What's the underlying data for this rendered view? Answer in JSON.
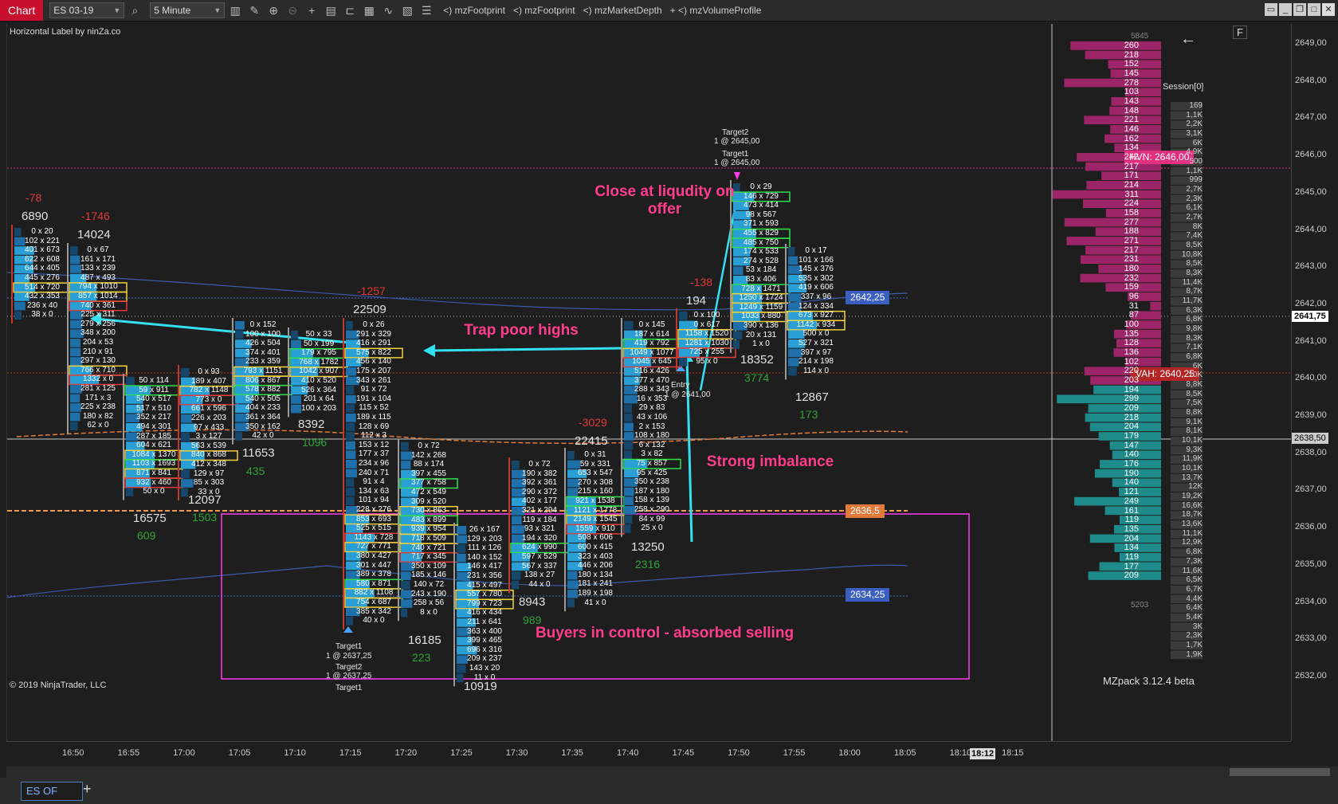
{
  "toolbar": {
    "chart_label": "Chart",
    "instrument": "ES 03-19",
    "interval": "5 Minute",
    "indicators": [
      "<) mzFootprint",
      "<) mzFootprint",
      "<) mzMarketDepth",
      "+ <) mzVolumeProfile"
    ]
  },
  "chart": {
    "top_left_label": "Horizontal Label by ninZa.co",
    "copyright": "© 2019 NinjaTrader, LLC",
    "watermark": "MZpack 3.12.4 beta",
    "profile_title": "Session[0]",
    "profile_top_value": "5845",
    "profile_bottom_value": "5203",
    "f_button": "F",
    "back_arrow": "←"
  },
  "price_axis": {
    "labels": [
      "2649,00",
      "2648,00",
      "2647,00",
      "2646,00",
      "2645,00",
      "2644,00",
      "2643,00",
      "2642,00",
      "2641,00",
      "2640,00",
      "2639,00",
      "2638,00",
      "2637,00",
      "2636,00",
      "2635,00",
      "2634,00",
      "2633,00",
      "2632,00"
    ],
    "current_price": "2641,75",
    "crosshair_price": "2638,50"
  },
  "time_axis": {
    "labels": [
      "16:50",
      "16:55",
      "17:00",
      "17:05",
      "17:10",
      "17:15",
      "17:20",
      "17:25",
      "17:30",
      "17:35",
      "17:40",
      "17:45",
      "17:50",
      "17:55",
      "18:00",
      "18:05",
      "18:10",
      "18:12",
      "18:15"
    ]
  },
  "tags": {
    "hvn": "HVN: 2646,00",
    "vah": "VAH: 2640,25",
    "tag_2642": "2642,25",
    "tag_2636": "2636,5",
    "tag_2634": "2634,25"
  },
  "annotations": {
    "close_liquidity": "Close at liqudity on offer",
    "trap_highs": "Trap poor highs",
    "strong_imbalance": "Strong imbalance",
    "buyers_control": "Buyers in control - absorbed selling"
  },
  "orders": {
    "target2_top": "Target2",
    "target2_top_fill": "1 @ 2645,00",
    "target1_top": "Target1",
    "target1_top_fill": "1 @ 2645,00",
    "entry": "Entry",
    "entry_fill": "1 @ 2641,00",
    "target1_bottom": "Target1",
    "target1_bottom_fill": "1 @ 2637,25",
    "target2_bottom": "Target2",
    "target2_bottom_fill": "1 @ 2637,25",
    "target1_bottom2": "Target1"
  },
  "bars": [
    {
      "time": "16:50",
      "volume": "6890",
      "delta": "-78",
      "rows": [
        "0 x 20",
        "102 x 221",
        "401 x 673",
        "622 x 608",
        "644 x 405",
        "445 x 276",
        "514 x 720",
        "432 x 353",
        "236 x 40",
        "38 x 0"
      ]
    },
    {
      "time": "16:55a",
      "volume": "14024",
      "delta": "-1746",
      "rows": [
        "0 x 67",
        "161 x 171",
        "133 x 239",
        "487 x 493",
        "794 x 1010",
        "857 x 1014",
        "740 x 361",
        "225 x 311",
        "279 x 256",
        "348 x 200",
        "204 x 53",
        "210 x 91",
        "297 x 130",
        "766 x 710",
        "1332 x 0",
        "281 x 125",
        "171 x 3",
        "225 x 238",
        "180 x 82",
        "62 x 0"
      ]
    },
    {
      "time": "16:55",
      "volume": "16575",
      "delta": "609",
      "rows": [
        "50 x 114",
        "59 x 911",
        "540 x 517",
        "517 x 510",
        "352 x 217",
        "494 x 301",
        "287 x 185",
        "604 x 621",
        "1084 x 1370",
        "1103 x 1693",
        "871 x 841",
        "932 x 460",
        "50 x 0"
      ]
    },
    {
      "time": "17:00",
      "volume": "12097",
      "delta": "1503",
      "rows": [
        "0 x 93",
        "189 x 407",
        "782 x 1148",
        "773 x 0",
        "661 x 596",
        "226 x 203",
        "97 x 433",
        "3 x 127",
        "563 x 539",
        "840 x 868",
        "412 x 348",
        "129 x 97",
        "85 x 303",
        "33 x 0"
      ]
    },
    {
      "time": "17:05",
      "volume": "11653",
      "delta": "435",
      "rows": [
        "0 x 152",
        "100 x 100",
        "426 x 504",
        "374 x 401",
        "233 x 359",
        "793 x 1151",
        "806 x 867",
        "578 x 882",
        "540 x 505",
        "404 x 233",
        "361 x 364",
        "350 x 162",
        "42 x 0"
      ]
    },
    {
      "time": "17:10",
      "volume": "8392",
      "delta": "1096",
      "rows": [
        "50 x 33",
        "50 x 199",
        "179 x 795",
        "768 x 1782",
        "1042 x 907",
        "410 x 520",
        "526 x 364",
        "201 x 64",
        "100 x 203"
      ]
    },
    {
      "time": "17:15",
      "volume": "22509",
      "delta": "-1257",
      "rows": [
        "0 x 26",
        "291 x 329",
        "416 x 291",
        "575 x 822",
        "456 x 140",
        "175 x 207",
        "343 x 261",
        "91 x 72",
        "191 x 104",
        "115 x 52",
        "189 x 115",
        "128 x 69",
        "112 x 3",
        "153 x 12",
        "177 x 37",
        "234 x 96",
        "240 x 71",
        "91 x 4",
        "134 x 63",
        "101 x 94",
        "228 x 276",
        "853 x 693",
        "525 x 515",
        "1143 x 728",
        "727 x 771",
        "380 x 427",
        "301 x 447",
        "389 x 378",
        "580 x 871",
        "882 x 1108",
        "754 x 687",
        "385 x 342",
        "40 x 0"
      ]
    },
    {
      "time": "17:20",
      "volume": "16185",
      "delta": "223",
      "rows": [
        "0 x 72",
        "142 x 268",
        "88 x 174",
        "397 x 455",
        "377 x 758",
        "472 x 549",
        "309 x 520",
        "730 x 863",
        "483 x 899",
        "939 x 954",
        "718 x 509",
        "740 x 721",
        "717 x 345",
        "350 x 109",
        "185 x 146",
        "140 x 72",
        "243 x 190",
        "258 x 56",
        "8 x 0"
      ]
    },
    {
      "time": "17:25",
      "volume": "10919",
      "delta": "",
      "rows": [
        "26 x 167",
        "129 x 203",
        "111 x 126",
        "140 x 152",
        "146 x 417",
        "231 x 356",
        "415 x 497",
        "557 x 780",
        "799 x 723",
        "416 x 434",
        "211 x 641",
        "363 x 400",
        "399 x 465",
        "696 x 316",
        "209 x 237",
        "143 x 20",
        "11 x 0"
      ]
    },
    {
      "time": "17:30",
      "volume": "8943",
      "delta": "989",
      "rows": [
        "0 x 72",
        "190 x 382",
        "392 x 361",
        "290 x 372",
        "402 x 177",
        "321 x 294",
        "119 x 184",
        "93 x 321",
        "194 x 320",
        "624 x 990",
        "597 x 529",
        "567 x 337",
        "138 x 27",
        "44 x 0"
      ]
    },
    {
      "time": "17:35",
      "volume": "22415",
      "delta": "-3029",
      "rows": [
        "0 x 31",
        "59 x 331",
        "653 x 547",
        "270 x 308",
        "215 x 160",
        "921 x 1538",
        "1121 x 1778",
        "2149 x 1545",
        "1559 x 910",
        "508 x 606",
        "600 x 415",
        "323 x 403",
        "446 x 206",
        "180 x 134",
        "181 x 241",
        "189 x 198",
        "41 x 0"
      ]
    },
    {
      "time": "17:40",
      "volume": "13250",
      "delta": "2316",
      "rows": [
        "0 x 145",
        "187 x 614",
        "419 x 792",
        "1049 x 1077",
        "1045 x 645",
        "516 x 426",
        "377 x 470",
        "288 x 343",
        "16 x 353",
        "29 x 83",
        "43 x 106",
        "2 x 153",
        "108 x 180",
        "6 x 132",
        "3 x 82",
        "75 x 857",
        "95 x 425",
        "350 x 238",
        "187 x 180",
        "158 x 139",
        "258 x 290",
        "84 x 99",
        "25 x 0"
      ]
    },
    {
      "time": "17:45",
      "volume": "194",
      "delta": "-138",
      "rows": [
        "0 x 100",
        "0 x 617",
        "1158 x 1520",
        "1281 x 1030",
        "725 x 255",
        "95 x 0"
      ]
    },
    {
      "time": "17:50",
      "volume": "18352",
      "delta": "3774",
      "rows": [
        "0 x 29",
        "146 x 729",
        "473 x 414",
        "98 x 567",
        "371 x 593",
        "455 x 829",
        "485 x 750",
        "174 x 533",
        "274 x 528",
        "53 x 184",
        "83 x 406",
        "728 x 1471",
        "1250 x 1724",
        "1249 x 1159",
        "1033 x 880",
        "390 x 136",
        "20 x 131",
        "1 x 0"
      ]
    },
    {
      "time": "17:55",
      "volume": "12867",
      "delta": "173",
      "rows": [
        "0 x 17",
        "101 x 166",
        "145 x 376",
        "535 x 302",
        "419 x 606",
        "337 x 96",
        "124 x 334",
        "673 x 927",
        "1142 x 934",
        "500 x 0",
        "527 x 321",
        "397 x 97",
        "214 x 198",
        "114 x 0"
      ]
    }
  ],
  "volume_profile": {
    "values": [
      "260",
      "218",
      "152",
      "145",
      "278",
      "103",
      "143",
      "148",
      "221",
      "146",
      "162",
      "134",
      "242",
      "217",
      "171",
      "214",
      "311",
      "224",
      "158",
      "277",
      "188",
      "271",
      "217",
      "231",
      "180",
      "232",
      "159",
      "96",
      "31",
      "87",
      "100",
      "135",
      "128",
      "136",
      "102",
      "220",
      "203",
      "194",
      "299",
      "209",
      "218",
      "204",
      "179",
      "147",
      "140",
      "176",
      "190",
      "140",
      "121",
      "249",
      "161",
      "119",
      "135",
      "204",
      "134",
      "119",
      "177",
      "209"
    ],
    "deltas": [
      "169",
      "1,1K",
      "2,2K",
      "3,1K",
      "6K",
      "4,9K",
      "500",
      "1,1K",
      "999",
      "2,7K",
      "2,3K",
      "6,1K",
      "2,7K",
      "8K",
      "7,4K",
      "8,5K",
      "10,8K",
      "8,5K",
      "8,3K",
      "11,4K",
      "8,7K",
      "11,7K",
      "6,3K",
      "6,8K",
      "9,8K",
      "8,3K",
      "7,1K",
      "6,8K",
      "6K",
      "10K",
      "8,8K",
      "8,5K",
      "7,5K",
      "8,8K",
      "9,1K",
      "8,1K",
      "10,1K",
      "9,3K",
      "11,9K",
      "10,1K",
      "13,7K",
      "12K",
      "19,2K",
      "16,6K",
      "18,7K",
      "13,6K",
      "11,1K",
      "12,9K",
      "6,8K",
      "7,3K",
      "11,6K",
      "6,5K",
      "6,7K",
      "4,4K",
      "6,4K",
      "5,4K",
      "3K",
      "2,3K",
      "1,7K",
      "1,9K"
    ]
  }
}
